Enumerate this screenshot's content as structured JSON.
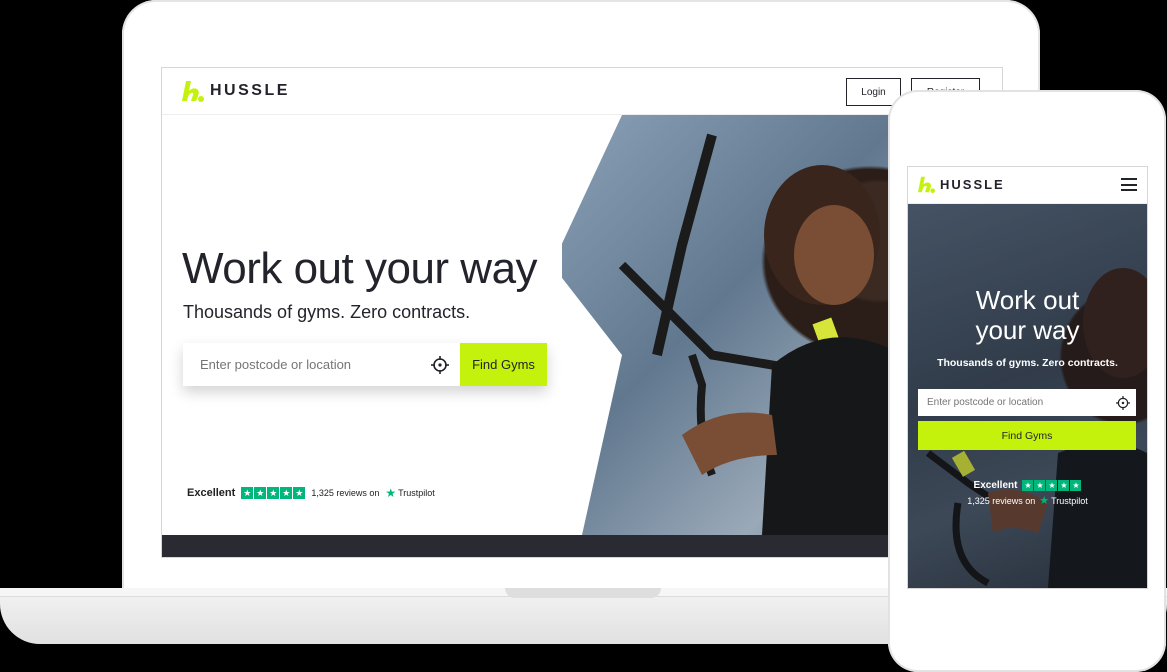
{
  "brand": {
    "name": "HUSSLE",
    "accent_color": "#c5f20c",
    "text_color": "#23232b"
  },
  "laptop": {
    "header": {
      "login_label": "Login",
      "register_label": "Register"
    },
    "hero": {
      "title": "Work out your way",
      "subtitle": "Thousands of gyms. Zero contracts.",
      "search_placeholder": "Enter postcode or location",
      "locate_icon": "crosshair-icon",
      "find_button": "Find Gyms"
    },
    "trustpilot": {
      "rating_label": "Excellent",
      "reviews_text": "1,325 reviews on",
      "brand": "Trustpilot",
      "stars": 5
    }
  },
  "phone": {
    "header": {
      "menu_icon": "hamburger-icon"
    },
    "hero": {
      "title_line1": "Work out",
      "title_line2": "your way",
      "subtitle": "Thousands of gyms. Zero contracts.",
      "search_placeholder": "Enter postcode or location",
      "find_button": "Find Gyms"
    },
    "trustpilot": {
      "rating_label": "Excellent",
      "reviews_text": "1,325 reviews on",
      "brand": "Trustpilot",
      "stars": 5
    }
  }
}
